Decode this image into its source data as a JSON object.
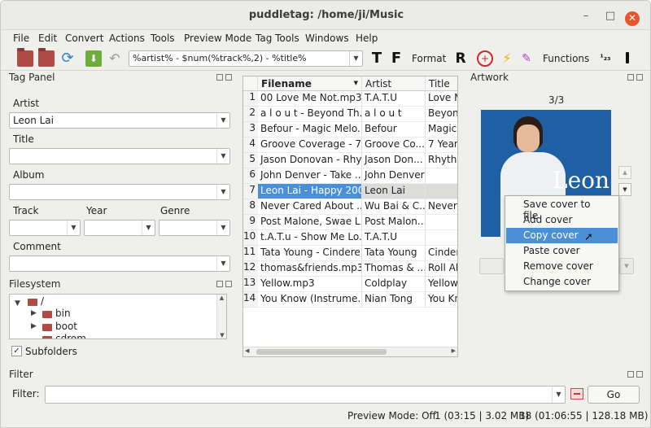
{
  "window": {
    "title": "puddletag: /home/ji/Music"
  },
  "menubar": [
    "File",
    "Edit",
    "Convert",
    "Actions",
    "Tools",
    "Preview Mode",
    "Tag Tools",
    "Windows",
    "Help"
  ],
  "toolbar": {
    "pattern": "%artist% - $num(%track%,2) - %title%",
    "format_label": "Format",
    "functions_label": "Functions"
  },
  "tag_panel": {
    "title": "Tag Panel",
    "artist_label": "Artist",
    "artist_value": "Leon Lai",
    "title_label": "Title",
    "album_label": "Album",
    "track_label": "Track",
    "year_label": "Year",
    "genre_label": "Genre",
    "comment_label": "Comment"
  },
  "filesystem": {
    "title": "Filesystem",
    "root": "/",
    "items": [
      "bin",
      "boot",
      "cdrom"
    ],
    "subfolders_label": "Subfolders"
  },
  "table": {
    "headers": [
      "Filename",
      "Artist",
      "Title"
    ],
    "rows": [
      [
        "1",
        "00 Love Me Not.mp3",
        "T.A.T.U",
        "Love M"
      ],
      [
        "2",
        "a l o u t - Beyond Th...",
        "a l o u t",
        "Beyon"
      ],
      [
        "3",
        "Befour - Magic  Melo...",
        "Befour",
        "Magic"
      ],
      [
        "4",
        "Groove Coverage - 7 ...",
        "Groove Co...",
        "7 Years"
      ],
      [
        "5",
        "Jason Donovan - Rhy...",
        "Jason Don...",
        "Rhythm"
      ],
      [
        "6",
        "John Denver - Take ...",
        "John Denver",
        ""
      ],
      [
        "7",
        "Leon Lai - Happy 200...",
        "Leon Lai",
        ""
      ],
      [
        "8",
        "Never Cared About ...",
        "Wu Bai & C...",
        "Never"
      ],
      [
        "9",
        "Post Malone, Swae L...",
        "Post Malon...",
        ""
      ],
      [
        "10",
        "t.A.T.u - Show Me Lo...",
        "T.A.T.U",
        ""
      ],
      [
        "11",
        "Tata Young - Cindere...",
        "Tata Young",
        "Cinder"
      ],
      [
        "12",
        "thomas&friends.mp3",
        "Thomas & ...",
        "Roll Al"
      ],
      [
        "13",
        "Yellow.mp3",
        "Coldplay",
        "Yellow"
      ],
      [
        "14",
        "You Know (Instrume...",
        "Nian Tong",
        "You Kn"
      ]
    ]
  },
  "artwork": {
    "title": "Artwork",
    "counter": "3/3",
    "image_text": "Leon"
  },
  "context_menu": [
    "Save cover to file",
    "Add cover",
    "Copy cover",
    "Paste cover",
    "Remove cover",
    "Change cover"
  ],
  "filter": {
    "title": "Filter",
    "label": "Filter:",
    "go_label": "Go"
  },
  "status": {
    "preview": "Preview Mode: Off",
    "selected": "1 (03:15 | 3.02 MB)",
    "total": "18 (01:06:55 | 128.18 MB)"
  },
  "colors": {
    "selection": "#4a90d9",
    "close_button": "#e9542c",
    "folder": "#b04a44"
  }
}
